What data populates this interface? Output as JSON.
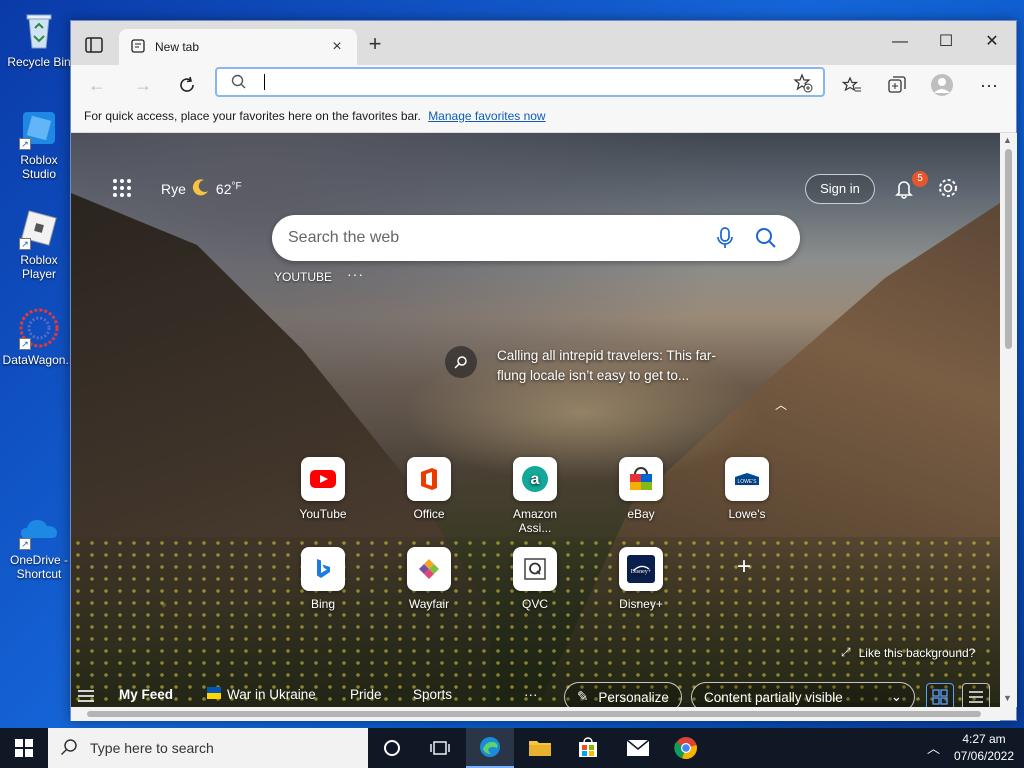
{
  "desktop": {
    "icons": [
      {
        "label": "Recycle Bin",
        "icon": "recycle-bin-icon"
      },
      {
        "label": "Roblox Studio",
        "icon": "roblox-studio-icon"
      },
      {
        "label": "Roblox Player",
        "icon": "roblox-player-icon"
      },
      {
        "label": "DataWagon...",
        "icon": "datawagon-icon"
      },
      {
        "label": "OneDrive - Shortcut",
        "icon": "onedrive-icon"
      }
    ]
  },
  "browser": {
    "tab": {
      "title": "New tab"
    },
    "address": {
      "value": ""
    },
    "favorites_bar": {
      "message": "For quick access, place your favorites here on the favorites bar.",
      "link": "Manage favorites now"
    }
  },
  "newtab": {
    "weather": {
      "location": "Rye",
      "temp": "62",
      "unit": "°F"
    },
    "signin": "Sign in",
    "notifications_count": "5",
    "search_placeholder": "Search the web",
    "quick_link_label": "YOUTUBE",
    "quick_more": "···",
    "hero_text": "Calling all intrepid travelers: This far-flung locale isn’t easy to get to...",
    "tiles_row1": [
      {
        "label": "YouTube",
        "icon": "youtube-icon"
      },
      {
        "label": "Office",
        "icon": "office-icon"
      },
      {
        "label": "Amazon Assi...",
        "icon": "amazon-assistant-icon"
      },
      {
        "label": "eBay",
        "icon": "ebay-icon"
      },
      {
        "label": "Lowe's",
        "icon": "lowes-icon"
      }
    ],
    "tiles_row2": [
      {
        "label": "Bing",
        "icon": "bing-icon"
      },
      {
        "label": "Wayfair",
        "icon": "wayfair-icon"
      },
      {
        "label": "QVC",
        "icon": "qvc-icon"
      },
      {
        "label": "Disney+",
        "icon": "disney-plus-icon"
      }
    ],
    "like_background": "Like this background?",
    "feed": {
      "my_feed": "My Feed",
      "items": [
        "War in Ukraine",
        "Pride",
        "Sports"
      ],
      "more": "···",
      "personalize": "Personalize",
      "content_visibility": "Content partially visible"
    }
  },
  "taskbar": {
    "search_placeholder": "Type here to search",
    "time": "4:27 am",
    "date": "07/06/2022"
  },
  "colors": {
    "accent": "#0f5cba",
    "badge": "#e4572e",
    "taskbar": "#101826"
  }
}
